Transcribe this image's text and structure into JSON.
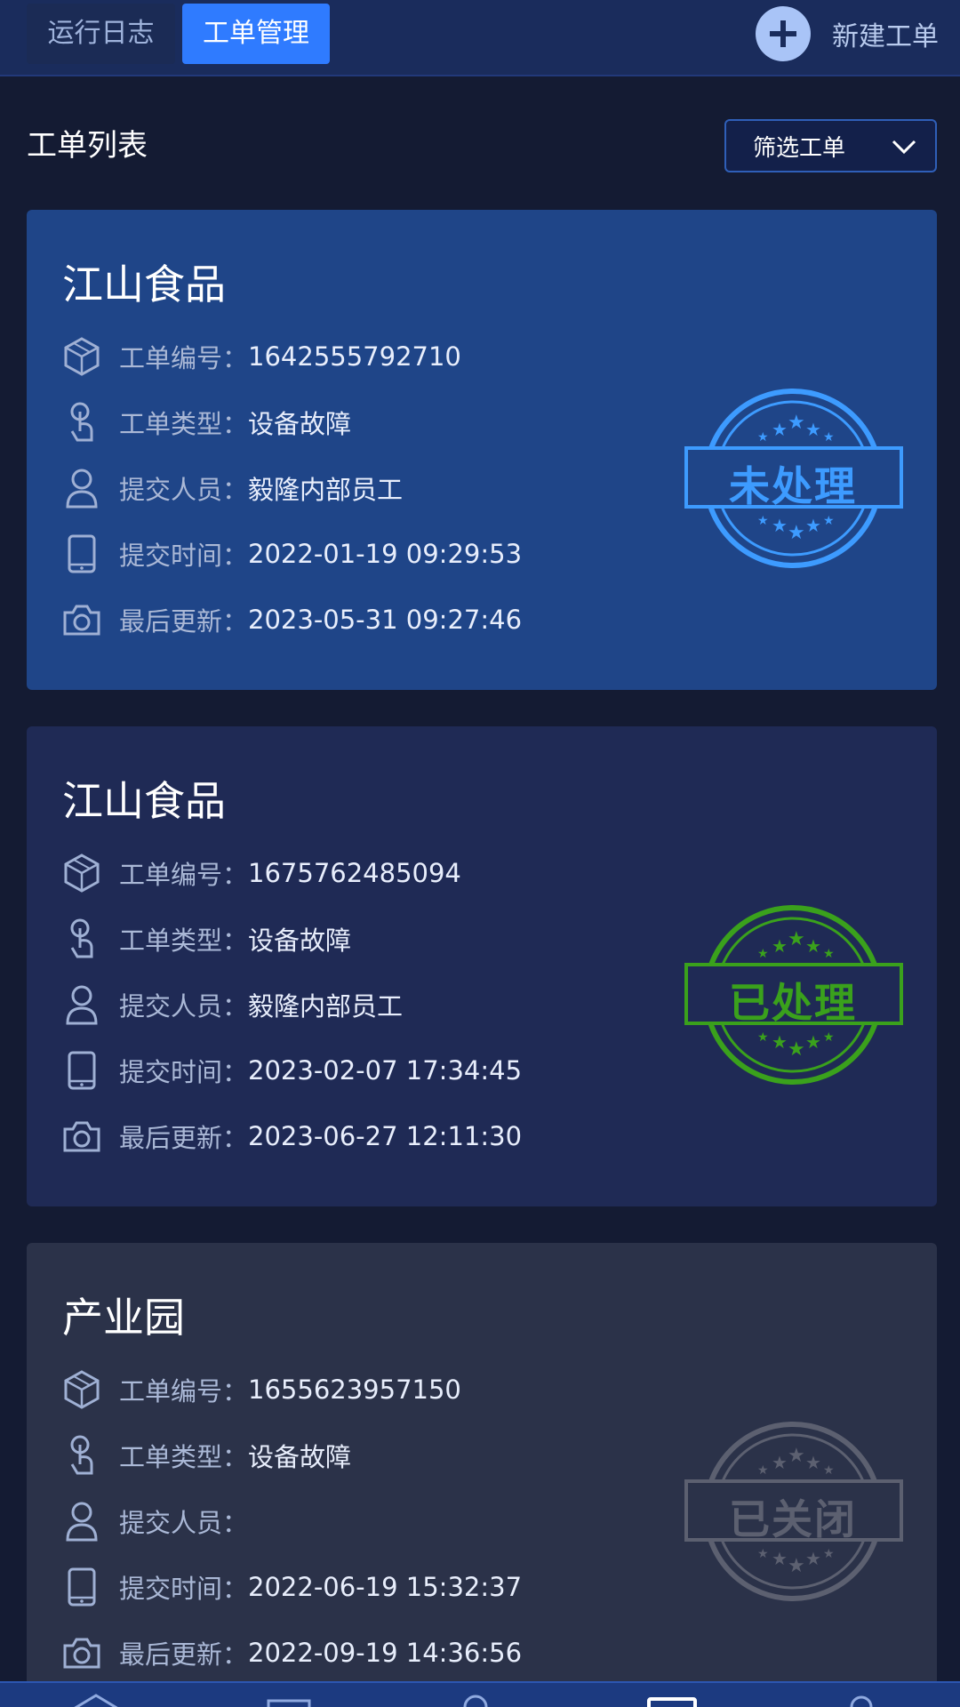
{
  "header": {
    "tabs": [
      {
        "label": "运行日志",
        "active": false
      },
      {
        "label": "工单管理",
        "active": true
      }
    ],
    "new_order_label": "新建工单"
  },
  "list": {
    "title": "工单列表",
    "filter_label": "筛选工单"
  },
  "field_labels": {
    "order_no": "工单编号：",
    "order_type": "工单类型：",
    "submitter": "提交人员：",
    "submit_time": "提交时间：",
    "last_update": "最后更新："
  },
  "orders": [
    {
      "company": "江山食品",
      "order_no": "1642555792710",
      "order_type": "设备故障",
      "submitter": "毅隆内部员工",
      "submit_time": "2022-01-19 09:29:53",
      "last_update": "2023-05-31 09:27:46",
      "status": "未处理",
      "status_color": "#3d9bff"
    },
    {
      "company": "江山食品",
      "order_no": "1675762485094",
      "order_type": "设备故障",
      "submitter": "毅隆内部员工",
      "submit_time": "2023-02-07 17:34:45",
      "last_update": "2023-06-27 12:11:30",
      "status": "已处理",
      "status_color": "#3aa11c"
    },
    {
      "company": "产业园",
      "order_no": "1655623957150",
      "order_type": "设备故障",
      "submitter": "",
      "submit_time": "2022-06-19 15:32:37",
      "last_update": "2022-09-19 14:36:56",
      "status": "已关闭",
      "status_color": "#5c6070"
    }
  ],
  "colors": {
    "accent": "#2f7bff",
    "header_bg": "#1a2c5c",
    "page_bg": "#141b33"
  },
  "icons": [
    "plus-icon",
    "chevron-down-icon",
    "cube-icon",
    "touch-icon",
    "user-icon",
    "tablet-icon",
    "camera-icon",
    "home-icon"
  ]
}
